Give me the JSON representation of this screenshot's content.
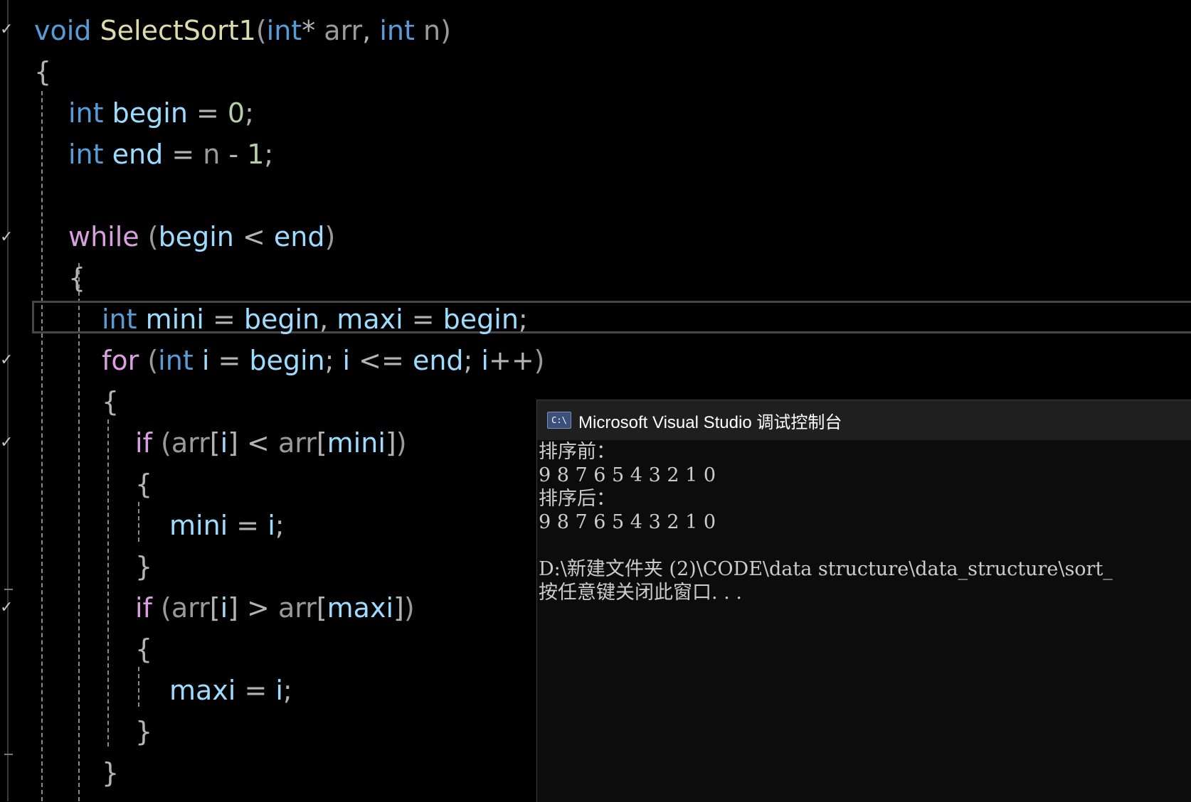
{
  "editor": {
    "lines": [
      {
        "tokens": [
          [
            "kw",
            "void"
          ],
          [
            "op",
            " "
          ],
          [
            "fn",
            "SelectSort1"
          ],
          [
            "par",
            "("
          ],
          [
            "kw",
            "int"
          ],
          [
            "op",
            "* "
          ],
          [
            "par",
            "arr"
          ],
          [
            "op",
            ", "
          ],
          [
            "kw",
            "int"
          ],
          [
            "op",
            " "
          ],
          [
            "par",
            "n"
          ],
          [
            "par",
            ")"
          ]
        ]
      },
      {
        "tokens": [
          [
            "op",
            "{"
          ]
        ]
      },
      {
        "tokens": [
          [
            "kw",
            "int"
          ],
          [
            "op",
            " "
          ],
          [
            "var",
            "begin"
          ],
          [
            "op",
            " = "
          ],
          [
            "num",
            "0"
          ],
          [
            "op",
            ";"
          ]
        ]
      },
      {
        "tokens": [
          [
            "kw",
            "int"
          ],
          [
            "op",
            " "
          ],
          [
            "var",
            "end"
          ],
          [
            "op",
            " = "
          ],
          [
            "par",
            "n"
          ],
          [
            "op",
            " - "
          ],
          [
            "num",
            "1"
          ],
          [
            "op",
            ";"
          ]
        ]
      },
      {
        "tokens": []
      },
      {
        "tokens": [
          [
            "ctl",
            "while"
          ],
          [
            "op",
            " "
          ],
          [
            "par",
            "("
          ],
          [
            "var",
            "begin"
          ],
          [
            "op",
            " < "
          ],
          [
            "var",
            "end"
          ],
          [
            "par",
            ")"
          ]
        ]
      },
      {
        "tokens": [
          [
            "op",
            "{"
          ]
        ]
      },
      {
        "tokens": [
          [
            "kw",
            "int"
          ],
          [
            "op",
            " "
          ],
          [
            "var",
            "mini"
          ],
          [
            "op",
            " = "
          ],
          [
            "var",
            "begin"
          ],
          [
            "op",
            ", "
          ],
          [
            "var",
            "maxi"
          ],
          [
            "op",
            " = "
          ],
          [
            "var",
            "begin"
          ],
          [
            "op",
            ";"
          ]
        ]
      },
      {
        "tokens": [
          [
            "ctl",
            "for"
          ],
          [
            "op",
            " "
          ],
          [
            "par",
            "("
          ],
          [
            "kw",
            "int"
          ],
          [
            "op",
            " "
          ],
          [
            "var",
            "i"
          ],
          [
            "op",
            " = "
          ],
          [
            "var",
            "begin"
          ],
          [
            "op",
            "; "
          ],
          [
            "var",
            "i"
          ],
          [
            "op",
            " <= "
          ],
          [
            "var",
            "end"
          ],
          [
            "op",
            "; "
          ],
          [
            "var",
            "i"
          ],
          [
            "op",
            "++"
          ],
          [
            "par",
            ")"
          ]
        ]
      },
      {
        "tokens": [
          [
            "op",
            "{"
          ]
        ]
      },
      {
        "tokens": [
          [
            "ctl",
            "if"
          ],
          [
            "op",
            " "
          ],
          [
            "par",
            "("
          ],
          [
            "par",
            "arr"
          ],
          [
            "op",
            "["
          ],
          [
            "var",
            "i"
          ],
          [
            "op",
            "]"
          ],
          [
            "op",
            " < "
          ],
          [
            "par",
            "arr"
          ],
          [
            "op",
            "["
          ],
          [
            "var",
            "mini"
          ],
          [
            "op",
            "]"
          ],
          [
            "par",
            ")"
          ]
        ]
      },
      {
        "tokens": [
          [
            "op",
            "{"
          ]
        ]
      },
      {
        "tokens": [
          [
            "var",
            "mini"
          ],
          [
            "op",
            " = "
          ],
          [
            "var",
            "i"
          ],
          [
            "op",
            ";"
          ]
        ]
      },
      {
        "tokens": [
          [
            "op",
            "}"
          ]
        ]
      },
      {
        "tokens": [
          [
            "ctl",
            "if"
          ],
          [
            "op",
            " "
          ],
          [
            "par",
            "("
          ],
          [
            "par",
            "arr"
          ],
          [
            "op",
            "["
          ],
          [
            "var",
            "i"
          ],
          [
            "op",
            "]"
          ],
          [
            "op",
            " > "
          ],
          [
            "par",
            "arr"
          ],
          [
            "op",
            "["
          ],
          [
            "var",
            "maxi"
          ],
          [
            "op",
            "]"
          ],
          [
            "par",
            ")"
          ]
        ]
      },
      {
        "tokens": [
          [
            "op",
            "{"
          ]
        ]
      },
      {
        "tokens": [
          [
            "var",
            "maxi"
          ],
          [
            "op",
            " = "
          ],
          [
            "var",
            "i"
          ],
          [
            "op",
            ";"
          ]
        ]
      },
      {
        "tokens": [
          [
            "op",
            "}"
          ]
        ]
      },
      {
        "tokens": [
          [
            "op",
            "}"
          ]
        ]
      }
    ]
  },
  "console": {
    "title": "Microsoft Visual Studio 调试控制台",
    "icon": "C:\\",
    "output_lines": [
      "排序前：",
      "9 8 7 6 5 4 3 2 1 0",
      "排序后：",
      "9 8 7 6 5 4 3 2 1 0",
      "",
      "D:\\新建文件夹 (2)\\CODE\\data structure\\data_structure\\sort_",
      "按任意键关闭此窗口. . ."
    ]
  }
}
